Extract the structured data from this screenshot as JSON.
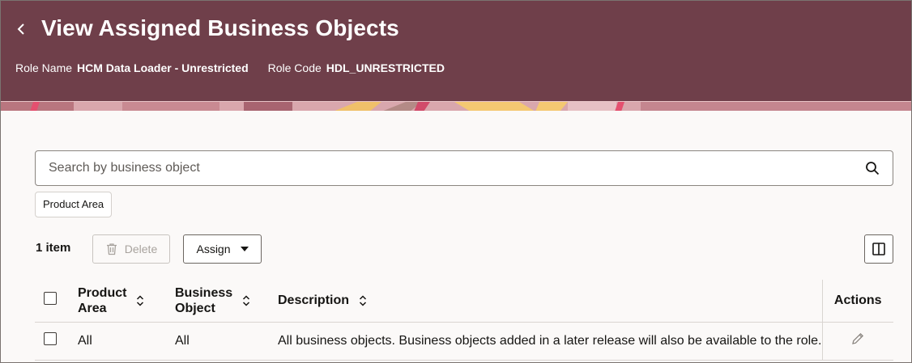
{
  "header": {
    "title": "View Assigned Business Objects",
    "role_name_label": "Role Name",
    "role_name_value": "HCM Data Loader - Unrestricted",
    "role_code_label": "Role Code",
    "role_code_value": "HDL_UNRESTRICTED",
    "back_icon": "chevron-left-icon",
    "bg_color": "#6f3f4a"
  },
  "search": {
    "placeholder": "Search by business object",
    "value": "",
    "icon": "search-icon"
  },
  "filters": {
    "chip_label": "Product Area"
  },
  "toolbar": {
    "count_label": "1 item",
    "delete_label": "Delete",
    "assign_label": "Assign",
    "columns_icon": "column-panel-icon"
  },
  "table": {
    "columns": {
      "product_area_line1": "Product",
      "product_area_line2": "Area",
      "business_object_line1": "Business",
      "business_object_line2": "Object",
      "description": "Description",
      "actions": "Actions"
    },
    "rows": [
      {
        "product_area": "All",
        "business_object": "All",
        "description": "All business objects. Business objects added in a later release will also be available to the role."
      }
    ]
  }
}
